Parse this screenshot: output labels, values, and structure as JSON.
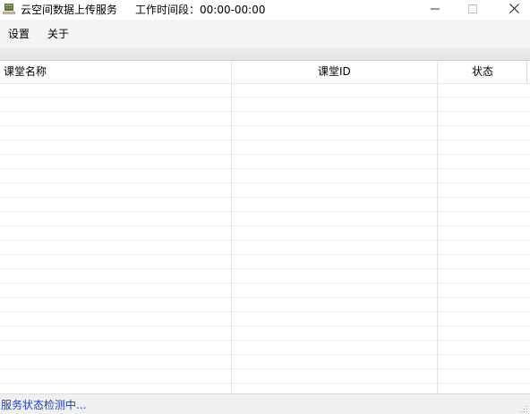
{
  "titlebar": {
    "app_title": "云空间数据上传服务",
    "hours": "工作时间段：00:00-00:00"
  },
  "menu": {
    "items": [
      {
        "label": "设置"
      },
      {
        "label": "关于"
      }
    ]
  },
  "grid": {
    "columns": [
      "课堂名称",
      "课堂ID",
      "状态"
    ],
    "rows": []
  },
  "status": {
    "text": "服务状态检测中..."
  },
  "icons": {
    "app": "server-app-icon",
    "minimize": "minimize-icon",
    "maximize": "maximize-icon",
    "close": "close-icon",
    "resize": "resize-grip-icon"
  },
  "colors": {
    "status_text": "#1a3fc4",
    "menubar_bg": "#f4f4f4",
    "statusbar_bg": "#f0f0f0"
  }
}
